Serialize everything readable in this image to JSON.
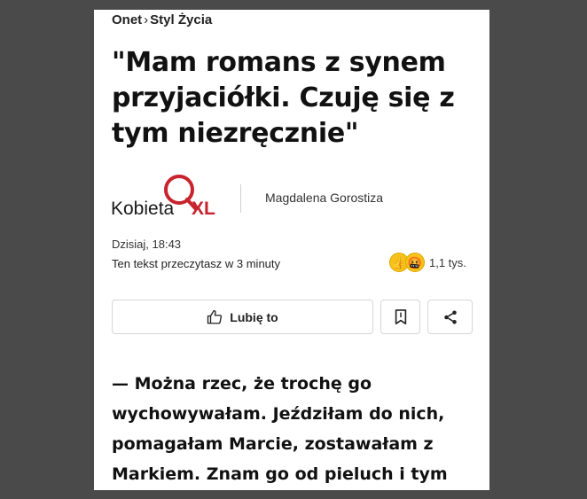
{
  "breadcrumb": {
    "site": "Onet",
    "separator": "›",
    "section": "Styl Życia"
  },
  "article": {
    "title": "\"Mam romans z synem przyjaciółki. Czuję się z tym niezręcznie\"",
    "logo": {
      "name": "KobietaXL",
      "text_left": "Kobieta",
      "text_right": "XL",
      "colors": {
        "text": "#1a1a1a",
        "accent": "#c8242e"
      }
    },
    "author": "Magdalena Gorostiza",
    "date": "Dzisiaj, 18:43",
    "read_time": "Ten tekst przeczytasz w 3 minuty",
    "reactions": {
      "icons": [
        "thumbs-up-emoji",
        "swearing-face-emoji"
      ],
      "count": "1,1 tys."
    },
    "lead": "— Można rzec, że trochę go wychowywałam. Jeździłam do nich, pomagałam Marcie, zostawałam z Markiem. Znam go od pieluch i tym"
  },
  "actions": {
    "like_label": "Lubię to",
    "like_icon": "thumbs-up-icon",
    "bookmark_icon": "bookmark-icon",
    "share_icon": "share-icon"
  }
}
